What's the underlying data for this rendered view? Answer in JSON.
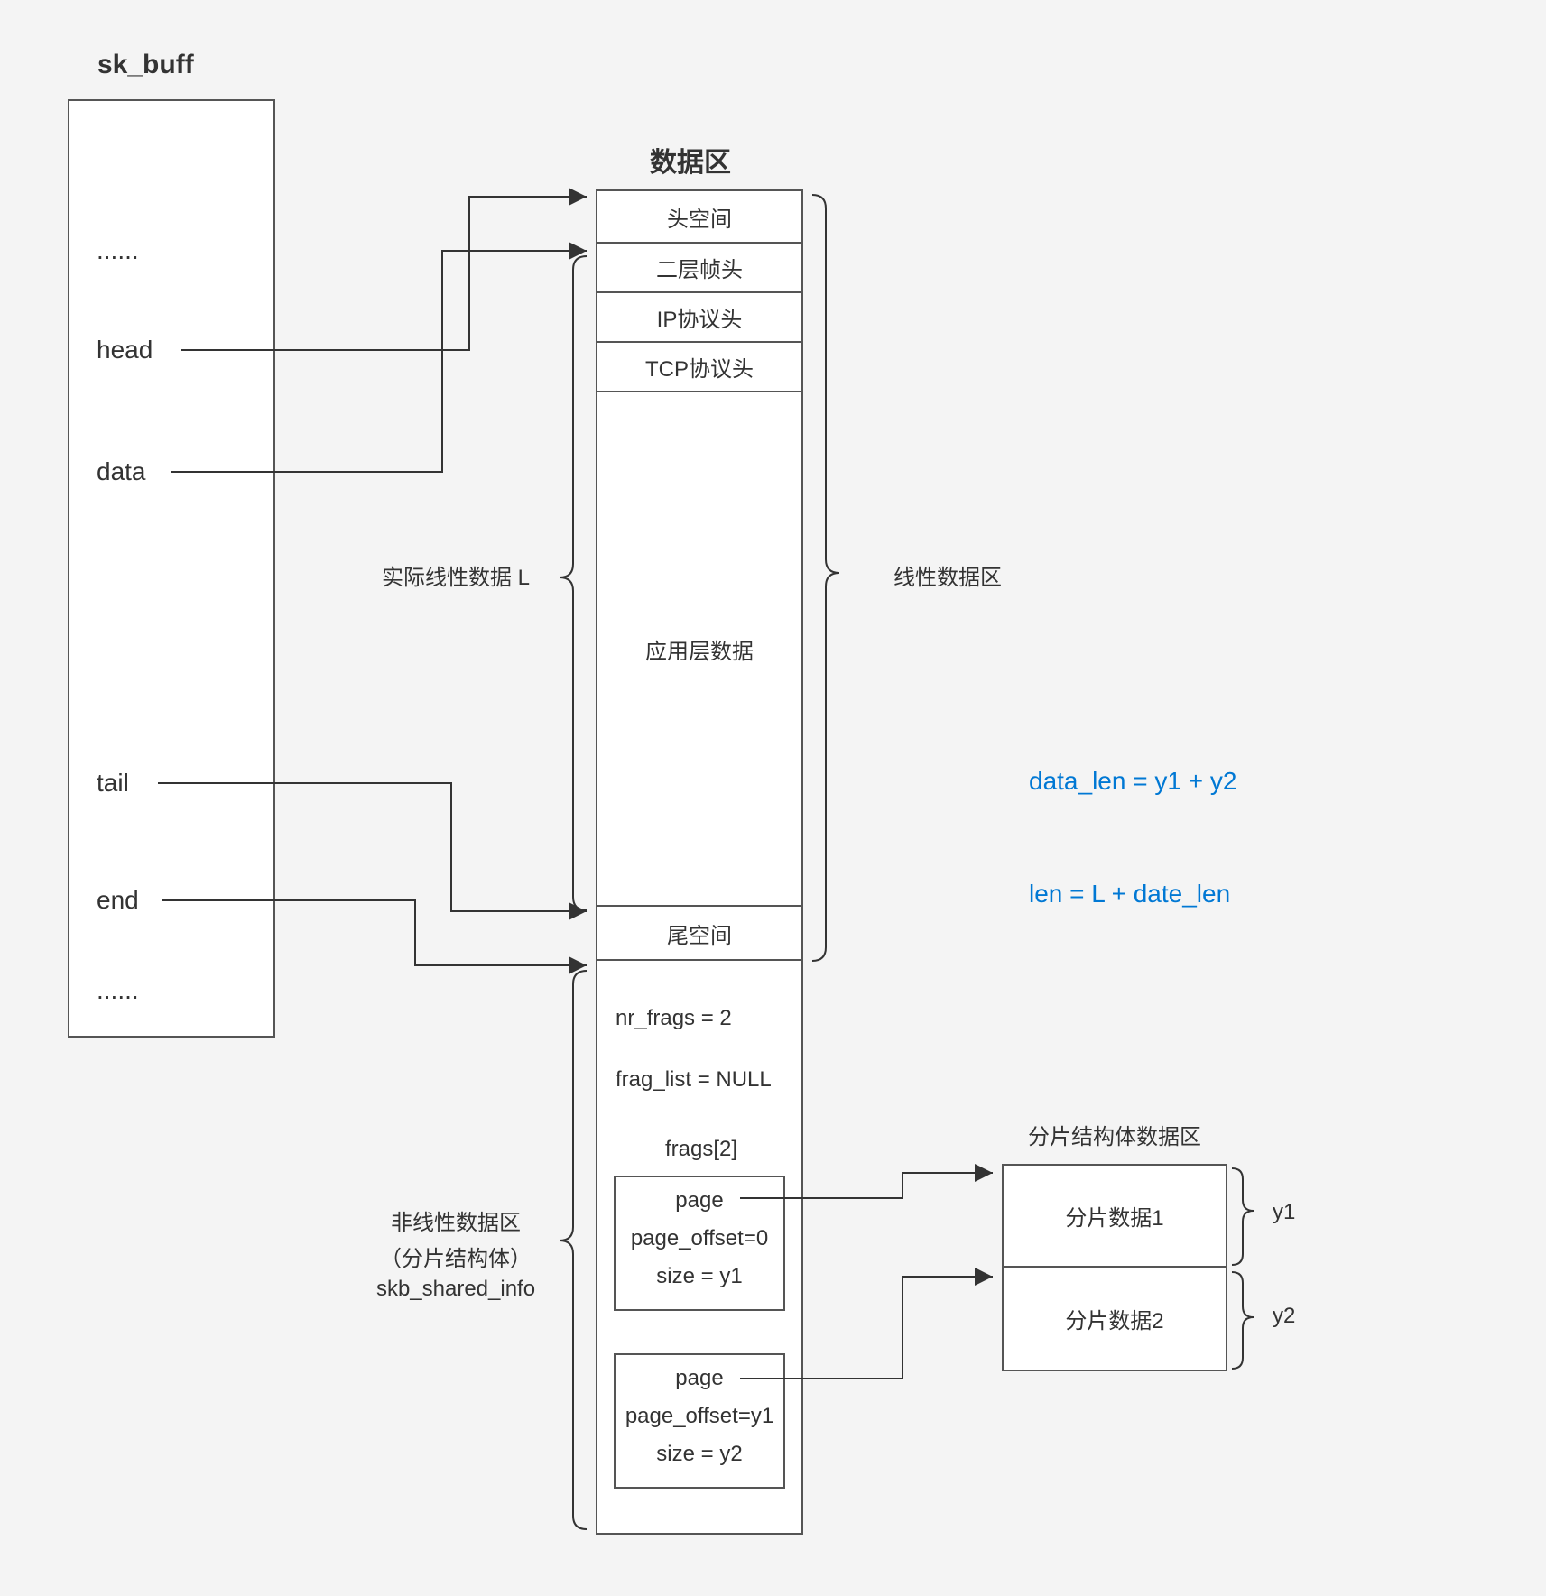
{
  "skbuff": {
    "title": "sk_buff",
    "items": {
      "dots1": "......",
      "head": "head",
      "data": "data",
      "tail": "tail",
      "end": "end",
      "dots2": "......"
    }
  },
  "dataArea": {
    "title": "数据区",
    "cells": {
      "headSpace": "头空间",
      "l2": "二层帧头",
      "ip": "IP协议头",
      "tcp": "TCP协议头",
      "appData": "应用层数据",
      "tailSpace": "尾空间"
    }
  },
  "sharedInfo": {
    "nrFrags": "nr_frags = 2",
    "fragList": "frag_list = NULL",
    "fragsArr": "frags[2]",
    "frag0": {
      "page": "page",
      "offset": "page_offset=0",
      "size": "size = y1"
    },
    "frag1": {
      "page": "page",
      "offset": "page_offset=y1",
      "size": "size = y2"
    }
  },
  "labels": {
    "actualLinearL": "实际线性数据 L",
    "linearArea": "线性数据区",
    "nonlinearArea1": "非线性数据区",
    "nonlinearArea2": "（分片结构体）",
    "nonlinearArea3": "skb_shared_info",
    "fragDataTitle": "分片结构体数据区",
    "fragData1": "分片数据1",
    "fragData2": "分片数据2",
    "y1": "y1",
    "y2": "y2"
  },
  "formulas": {
    "dataLen": "data_len = y1 + y2",
    "len": "len = L + date_len"
  }
}
